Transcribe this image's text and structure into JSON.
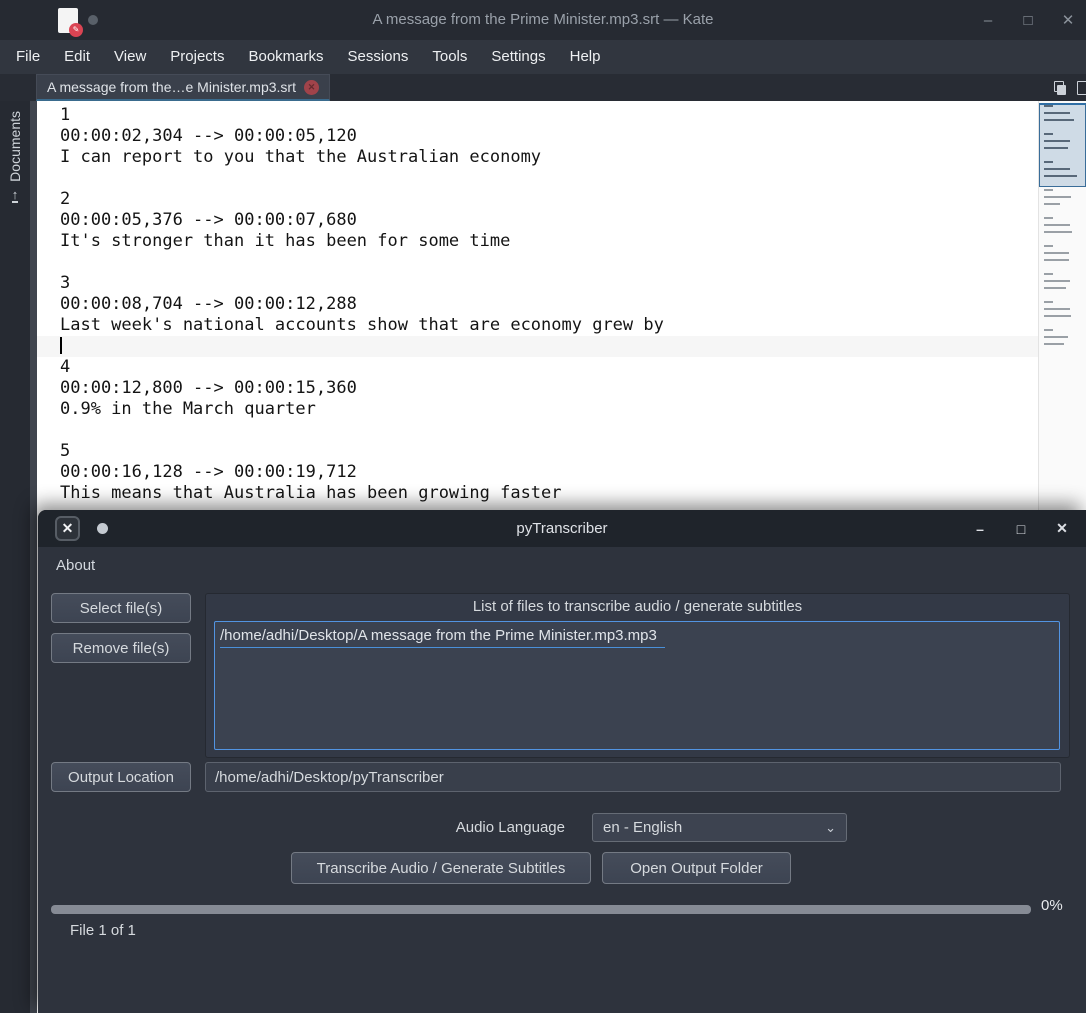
{
  "kate": {
    "window_title": "A message from the Prime Minister.mp3.srt — Kate",
    "menu_items": [
      "File",
      "Edit",
      "View",
      "Projects",
      "Bookmarks",
      "Sessions",
      "Tools",
      "Settings",
      "Help"
    ],
    "tab": {
      "label": "A message from the…e Minister.mp3.srt"
    },
    "sidebar": {
      "documents_label": "Documents"
    },
    "editor": {
      "lines": [
        "1",
        "00:00:02,304 --> 00:00:05,120",
        "I can report to you that the Australian economy",
        "",
        "2",
        "00:00:05,376 --> 00:00:07,680",
        "It's stronger than it has been for some time",
        "",
        "3",
        "00:00:08,704 --> 00:00:12,288",
        "Last week's national accounts show that are economy grew by",
        "",
        "4",
        "00:00:12,800 --> 00:00:15,360",
        "0.9% in the March quarter",
        "",
        "5",
        "00:00:16,128 --> 00:00:19,712",
        "This means that Australia has been growing faster"
      ],
      "cursor_line_index": 11
    }
  },
  "pytranscriber": {
    "window_title": "pyTranscriber",
    "menu_items": [
      "About"
    ],
    "select_files_button": "Select file(s)",
    "remove_files_button": "Remove file(s)",
    "file_list": {
      "group_title": "List of files to transcribe audio / generate subtitles",
      "items": [
        "/home/adhi/Desktop/A message from the Prime Minister.mp3.mp3"
      ]
    },
    "output_location_button": "Output Location",
    "output_location_value": "/home/adhi/Desktop/pyTranscriber",
    "audio_language_label": "Audio Language",
    "audio_language_value": "en - English",
    "transcribe_button": "Transcribe Audio / Generate Subtitles",
    "open_output_button": "Open Output Folder",
    "progress": {
      "value": 0,
      "percent_label": "0%"
    },
    "file_counter": "File 1 of 1"
  },
  "icons": {
    "minimize": "–",
    "maximize": "□",
    "close": "✕",
    "tab_close": "✕",
    "chevron_down": "⌄",
    "upload_arrow": "↑",
    "app_badge_pencil": "✎",
    "pytranscriber_logo": "✕"
  },
  "colors": {
    "kate_titlebar": "#262a32",
    "kate_menubar": "#31363f",
    "editor_bg": "#ffffff",
    "current_line_bg": "#f6f6f6",
    "active_tab_underline": "#3a6b8d",
    "pyt_titlebar": "#1f242b",
    "pyt_body": "#2e333d",
    "accent_border": "#5294e2",
    "item_underline": "#4a90d9",
    "tab_close_red": "#a0434a"
  }
}
